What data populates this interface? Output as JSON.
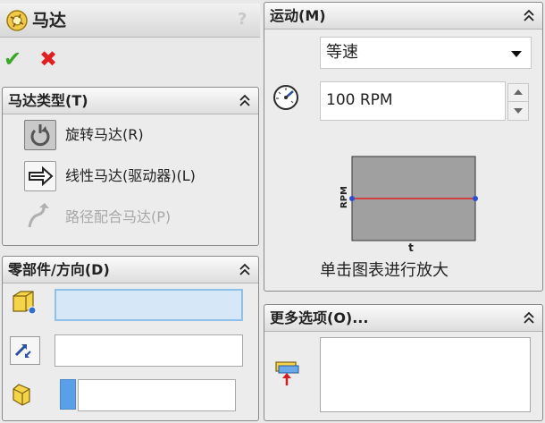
{
  "title": {
    "text": "马达",
    "help": "?"
  },
  "actions": {
    "ok": "✔",
    "cancel": "✖"
  },
  "motor_type": {
    "header": "马达类型(T)",
    "options": [
      {
        "label": "旋转马达(R)",
        "selected": true,
        "enabled": true
      },
      {
        "label": "线性马达(驱动器)(L)",
        "selected": false,
        "enabled": true
      },
      {
        "label": "路径配合马达(P)",
        "selected": false,
        "enabled": false
      }
    ]
  },
  "component_direction": {
    "header": "零部件/方向(D)"
  },
  "motion": {
    "header": "运动(M)",
    "type_value": "等速",
    "speed_value": "100 RPM",
    "graph": {
      "y_label": "RPM",
      "x_label": "t",
      "line_color": "#e02020",
      "bg_color": "#a0a0a0",
      "values": [
        100,
        100
      ]
    },
    "hint": "单击图表进行放大"
  },
  "more_options": {
    "header": "更多选项(O)..."
  },
  "colors": {
    "ok": "#3aa62a",
    "cancel": "#e02020",
    "active_field": "#d6e8f8"
  }
}
